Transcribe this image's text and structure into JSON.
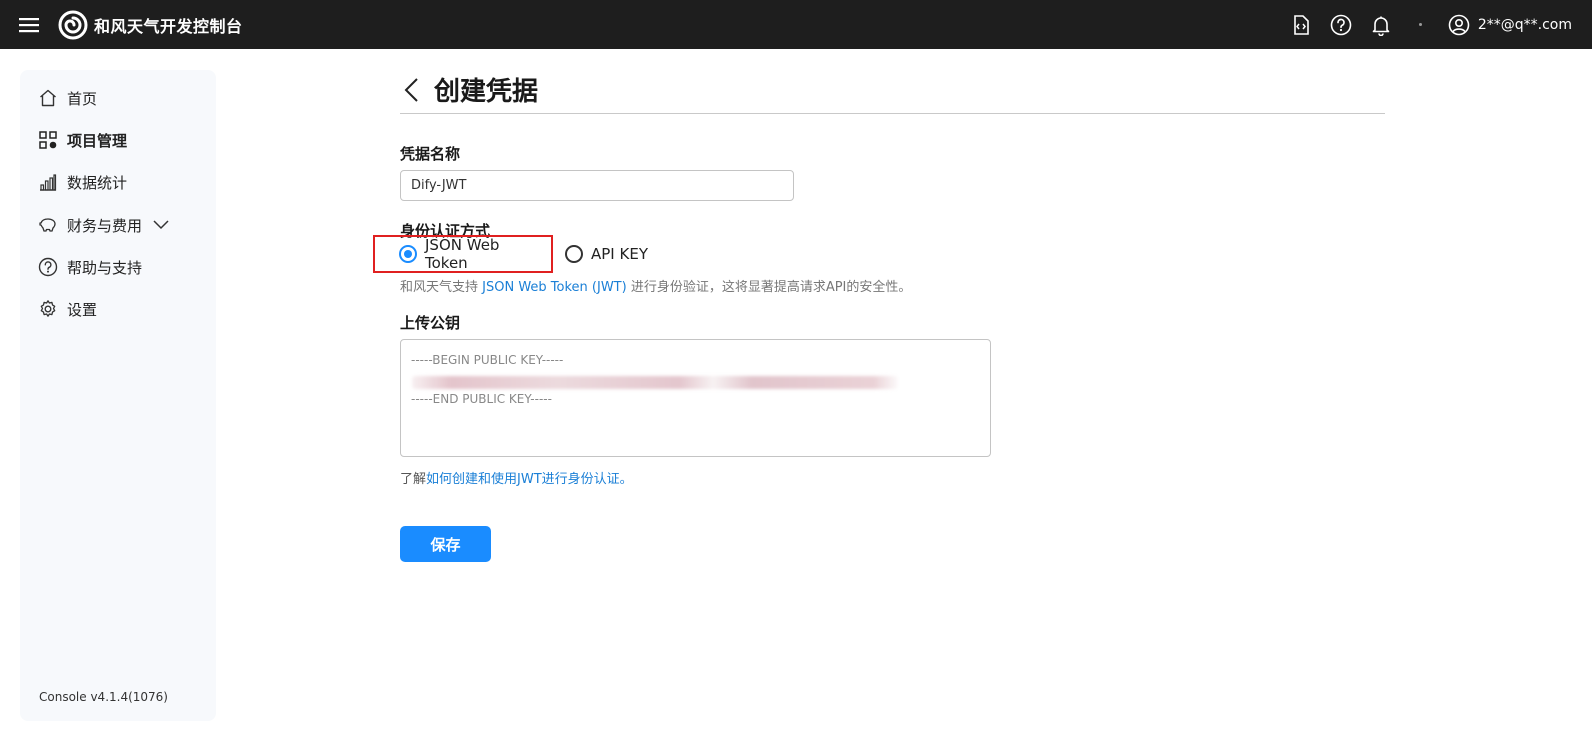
{
  "app": {
    "brand_name": "和风天气开发控制台",
    "user_email": "2**@q**.com"
  },
  "sidebar": {
    "items": [
      {
        "label": "首页",
        "icon": "home-icon"
      },
      {
        "label": "项目管理",
        "icon": "grid-icon",
        "active": true
      },
      {
        "label": "数据统计",
        "icon": "bar-chart-icon"
      },
      {
        "label": "财务与费用",
        "icon": "piggy-bank-icon",
        "has_dropdown": true
      },
      {
        "label": "帮助与支持",
        "icon": "help-icon"
      },
      {
        "label": "设置",
        "icon": "gear-icon"
      }
    ],
    "version": "Console v4.1.4(1076)"
  },
  "page": {
    "title": "创建凭据"
  },
  "form": {
    "name_label": "凭据名称",
    "name_value": "Dify-JWT",
    "auth_label": "身份认证方式",
    "auth_options": [
      {
        "label": "JSON Web Token",
        "checked": true
      },
      {
        "label": "API KEY",
        "checked": false
      }
    ],
    "hint_prefix": "和风天气支持 ",
    "hint_link": "JSON Web Token (JWT)",
    "hint_suffix": " 进行身份验证，这将显著提高请求API的安全性。",
    "key_label": "上传公钥",
    "key_value": "-----BEGIN PUBLIC KEY-----\n\n-----END PUBLIC KEY-----",
    "learn_prefix": "了解",
    "learn_link": "如何创建和使用JWT进行身份认证。",
    "save_label": "保存"
  },
  "colors": {
    "accent": "#1a8cff",
    "topbar": "#1e1e1e",
    "highlight": "#e02020",
    "link": "#1a7fd6"
  }
}
